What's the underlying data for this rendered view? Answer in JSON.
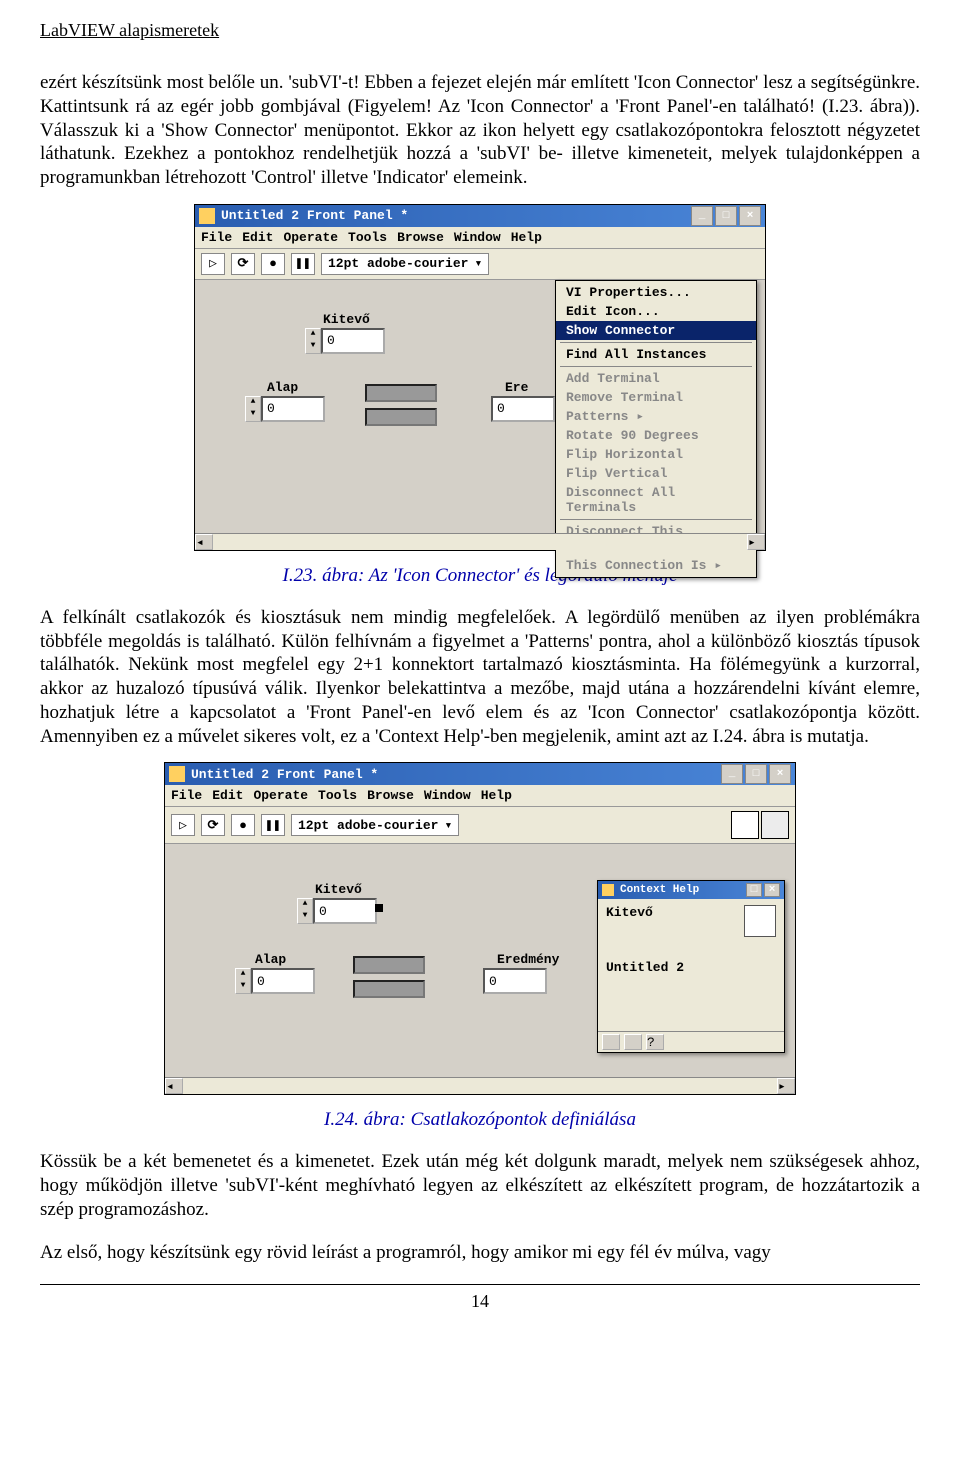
{
  "header": {
    "title": "LabVIEW alapismeretek"
  },
  "para1": "ezért készítsünk most belőle un. 'subVI'-t! Ebben a fejezet elején már említett 'Icon Connector' lesz a segítségünkre. Kattintsunk rá az egér jobb gombjával (Figyelem! Az 'Icon Connector' a 'Front Panel'-en található! (I.23. ábra)). Válasszuk ki a 'Show Connector' menüpontot. Ekkor az ikon helyett egy csatlakozópontokra felosztott négyzetet láthatunk. Ezekhez a pontokhoz rendelhetjük hozzá a 'subVI' be- illetve kimeneteit, melyek tulajdonképpen a programunkban létrehozott 'Control' illetve 'Indicator' elemeink.",
  "fig1_caption": "I.23. ábra: Az 'Icon Connector' és legördülő menüje",
  "para2": "A felkínált csatlakozók és kiosztásuk nem mindig megfelelőek. A legördülő menüben az ilyen problémákra többféle megoldás is található. Külön felhívnám a figyelmet a 'Patterns' pontra, ahol a különböző kiosztás típusok találhatók. Nekünk most megfelel egy 2+1 konnektort tartalmazó kiosztásminta. Ha fölémegyünk a kurzorral, akkor az huzalozó típusúvá válik. Ilyenkor belekattintva a mezőbe, majd utána a hozzárendelni kívánt elemre, hozhatjuk létre a kapcsolatot a 'Front Panel'-en levő elem és az 'Icon Connector' csatlakozópontja között. Amennyiben ez a művelet sikeres volt, ez a 'Context Help'-ben megjelenik, amint azt az I.24. ábra is mutatja.",
  "fig2_caption": "I.24. ábra: Csatlakozópontok definiálása",
  "para3": "Kössük be a két bemenetet és a kimenetet. Ezek után még két dolgunk maradt, melyek nem szükségesek ahhoz, hogy működjön illetve 'subVI'-ként meghívható legyen az elkészített az elkészített program, de hozzátartozik a szép programozáshoz.",
  "para4": "Az első, hogy készítsünk egy rövid leírást a programról, hogy amikor mi egy fél év múlva, vagy",
  "page_number": "14",
  "ssA": {
    "title": "Untitled 2 Front Panel *",
    "menu": [
      "File",
      "Edit",
      "Operate",
      "Tools",
      "Browse",
      "Window",
      "Help"
    ],
    "font_field": "12pt adobe-courier",
    "labels": {
      "kitevo": "Kitevő",
      "alap": "Alap",
      "ere": "Ere"
    },
    "values": {
      "kitevo": "0",
      "alap": "0",
      "ere": "0"
    },
    "context_menu": [
      {
        "t": "VI Properties...",
        "s": "n"
      },
      {
        "t": "Edit Icon...",
        "s": "n"
      },
      {
        "t": "Show Connector",
        "s": "hl"
      },
      {
        "t": "",
        "s": "sep"
      },
      {
        "t": "Find All Instances",
        "s": "n"
      },
      {
        "t": "",
        "s": "sep"
      },
      {
        "t": "Add Terminal",
        "s": "d"
      },
      {
        "t": "Remove Terminal",
        "s": "d"
      },
      {
        "t": "Patterns",
        "s": "d",
        "arrow": true
      },
      {
        "t": "Rotate 90 Degrees",
        "s": "d"
      },
      {
        "t": "Flip Horizontal",
        "s": "d"
      },
      {
        "t": "Flip Vertical",
        "s": "d"
      },
      {
        "t": "Disconnect All Terminals",
        "s": "d"
      },
      {
        "t": "",
        "s": "sep"
      },
      {
        "t": "Disconnect This Terminal",
        "s": "d"
      },
      {
        "t": "This Connection Is",
        "s": "d",
        "arrow": true
      }
    ]
  },
  "ssB": {
    "title": "Untitled 2 Front Panel *",
    "menu": [
      "File",
      "Edit",
      "Operate",
      "Tools",
      "Browse",
      "Window",
      "Help"
    ],
    "font_field": "12pt adobe-courier",
    "labels": {
      "kitevo": "Kitevő",
      "alap": "Alap",
      "eredm": "Eredmény"
    },
    "values": {
      "kitevo": "0",
      "alap": "0",
      "eredm": "0"
    },
    "help_title": "Context Help",
    "help_label": "Kitevő",
    "help_name": "Untitled 2"
  }
}
